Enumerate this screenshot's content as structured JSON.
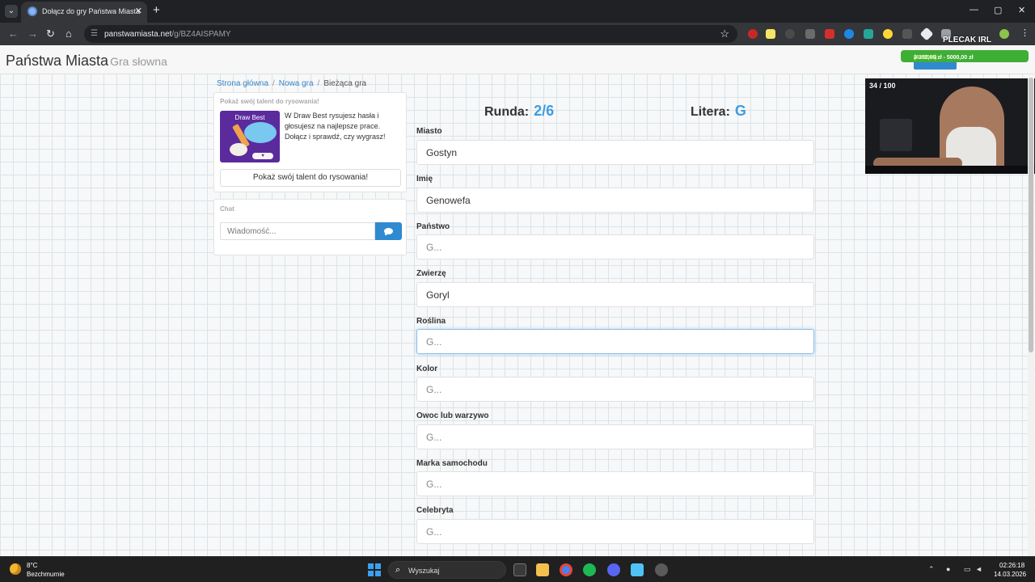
{
  "browser": {
    "tab_title": "Dołącz do gry Państwa Miasta",
    "tab_close": "✕",
    "new_tab": "+",
    "tab_list": "⌄",
    "url_domain": "panstwamiasta.net",
    "url_path": "/g/BZ4AISPAMY",
    "profile_label": "PLECAK IRL",
    "min": "—",
    "max": "▢",
    "close": "✕"
  },
  "site": {
    "brand": "Państwa Miasta",
    "brand_sub": "Gra słowna"
  },
  "breadcrumb": {
    "home": "Strona główna",
    "new_game": "Nowa gra",
    "current": "Bieżąca gra",
    "sep": "/"
  },
  "promo": {
    "title": "Pokaż swój talent do rysowania!",
    "image_title": "Draw Best",
    "text": "W Draw Best rysujesz hasła i głosujesz na najlepsze prace. Dołącz i sprawdź, czy wygrasz!",
    "button": "Pokaż swój talent do rysowania!"
  },
  "chat": {
    "title": "Chat",
    "placeholder": "Wiadomość..."
  },
  "game": {
    "round_label": "Runda:",
    "round_value": "2/6",
    "letter_label": "Litera:",
    "letter_value": "G",
    "fields": [
      {
        "label": "Miasto",
        "value": "Gostyn",
        "placeholder": "G..."
      },
      {
        "label": "Imię",
        "value": "Genowefa",
        "placeholder": "G..."
      },
      {
        "label": "Państwo",
        "value": "",
        "placeholder": "G..."
      },
      {
        "label": "Zwierzę",
        "value": "Goryl",
        "placeholder": "G..."
      },
      {
        "label": "Roślina",
        "value": "",
        "placeholder": "G..."
      },
      {
        "label": "Kolor",
        "value": "",
        "placeholder": "G..."
      },
      {
        "label": "Owoc lub warzywo",
        "value": "",
        "placeholder": "G..."
      },
      {
        "label": "Marka samochodu",
        "value": "",
        "placeholder": "G..."
      },
      {
        "label": "Celebryta",
        "value": "",
        "placeholder": "G..."
      }
    ]
  },
  "overlay": {
    "donation": "2 192,65 zł - 5000,00 zł",
    "donation_pct": "(43.85%)",
    "counter": "34 / 100"
  },
  "taskbar": {
    "temp": "8°C",
    "weather": "Bezchmurnie",
    "search": "Wyszukaj",
    "time": "02:26:18",
    "date": "14.03.2026"
  },
  "colors": {
    "accent": "#2f8ad0",
    "status_value": "#3d9de0"
  }
}
